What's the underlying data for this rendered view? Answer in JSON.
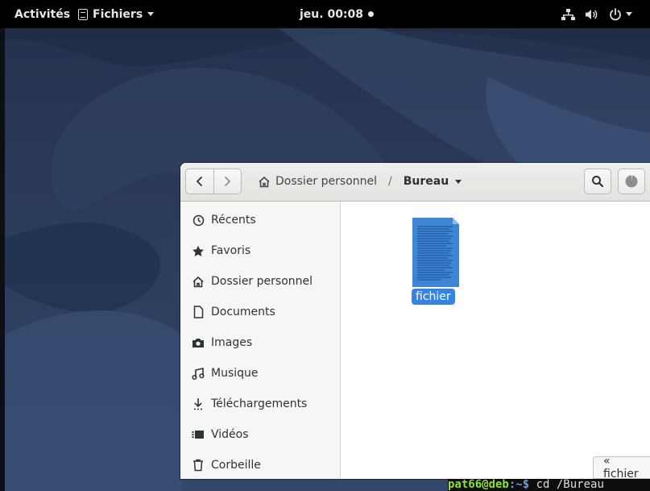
{
  "topbar": {
    "activities": "Activités",
    "app_menu": "Fichiers",
    "clock": "jeu. 00:08"
  },
  "terminal": {
    "user": "pat66@deb",
    "path": ":~$",
    "command": " cd /Bureau"
  },
  "window": {
    "breadcrumb": {
      "home": "Dossier personnel",
      "separator": "/",
      "current": "Bureau"
    },
    "sidebar": {
      "items": [
        {
          "label": "Récents",
          "icon": "clock-icon"
        },
        {
          "label": "Favoris",
          "icon": "star-icon"
        },
        {
          "label": "Dossier personnel",
          "icon": "home-icon"
        },
        {
          "label": "Documents",
          "icon": "document-icon"
        },
        {
          "label": "Images",
          "icon": "camera-icon"
        },
        {
          "label": "Musique",
          "icon": "music-icon"
        },
        {
          "label": "Téléchargements",
          "icon": "download-icon"
        },
        {
          "label": "Vidéos",
          "icon": "video-icon"
        },
        {
          "label": "Corbeille",
          "icon": "trash-icon"
        }
      ]
    },
    "files": [
      {
        "name": "fichier",
        "icon": "text-document-icon",
        "selected": true
      }
    ],
    "status": "« fichier"
  },
  "colors": {
    "accent": "#3584e4",
    "desktop": "#2b3a57",
    "topbar": "#000000"
  }
}
